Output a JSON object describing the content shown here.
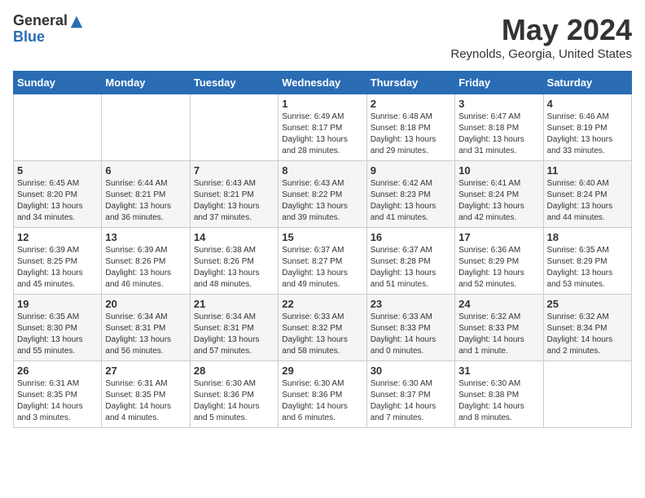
{
  "logo": {
    "general": "General",
    "blue": "Blue"
  },
  "title": "May 2024",
  "subtitle": "Reynolds, Georgia, United States",
  "days_header": [
    "Sunday",
    "Monday",
    "Tuesday",
    "Wednesday",
    "Thursday",
    "Friday",
    "Saturday"
  ],
  "weeks": [
    [
      {
        "day": "",
        "sunrise": "",
        "sunset": "",
        "daylight": ""
      },
      {
        "day": "",
        "sunrise": "",
        "sunset": "",
        "daylight": ""
      },
      {
        "day": "",
        "sunrise": "",
        "sunset": "",
        "daylight": ""
      },
      {
        "day": "1",
        "sunrise": "Sunrise: 6:49 AM",
        "sunset": "Sunset: 8:17 PM",
        "daylight": "Daylight: 13 hours and 28 minutes."
      },
      {
        "day": "2",
        "sunrise": "Sunrise: 6:48 AM",
        "sunset": "Sunset: 8:18 PM",
        "daylight": "Daylight: 13 hours and 29 minutes."
      },
      {
        "day": "3",
        "sunrise": "Sunrise: 6:47 AM",
        "sunset": "Sunset: 8:18 PM",
        "daylight": "Daylight: 13 hours and 31 minutes."
      },
      {
        "day": "4",
        "sunrise": "Sunrise: 6:46 AM",
        "sunset": "Sunset: 8:19 PM",
        "daylight": "Daylight: 13 hours and 33 minutes."
      }
    ],
    [
      {
        "day": "5",
        "sunrise": "Sunrise: 6:45 AM",
        "sunset": "Sunset: 8:20 PM",
        "daylight": "Daylight: 13 hours and 34 minutes."
      },
      {
        "day": "6",
        "sunrise": "Sunrise: 6:44 AM",
        "sunset": "Sunset: 8:21 PM",
        "daylight": "Daylight: 13 hours and 36 minutes."
      },
      {
        "day": "7",
        "sunrise": "Sunrise: 6:43 AM",
        "sunset": "Sunset: 8:21 PM",
        "daylight": "Daylight: 13 hours and 37 minutes."
      },
      {
        "day": "8",
        "sunrise": "Sunrise: 6:43 AM",
        "sunset": "Sunset: 8:22 PM",
        "daylight": "Daylight: 13 hours and 39 minutes."
      },
      {
        "day": "9",
        "sunrise": "Sunrise: 6:42 AM",
        "sunset": "Sunset: 8:23 PM",
        "daylight": "Daylight: 13 hours and 41 minutes."
      },
      {
        "day": "10",
        "sunrise": "Sunrise: 6:41 AM",
        "sunset": "Sunset: 8:24 PM",
        "daylight": "Daylight: 13 hours and 42 minutes."
      },
      {
        "day": "11",
        "sunrise": "Sunrise: 6:40 AM",
        "sunset": "Sunset: 8:24 PM",
        "daylight": "Daylight: 13 hours and 44 minutes."
      }
    ],
    [
      {
        "day": "12",
        "sunrise": "Sunrise: 6:39 AM",
        "sunset": "Sunset: 8:25 PM",
        "daylight": "Daylight: 13 hours and 45 minutes."
      },
      {
        "day": "13",
        "sunrise": "Sunrise: 6:39 AM",
        "sunset": "Sunset: 8:26 PM",
        "daylight": "Daylight: 13 hours and 46 minutes."
      },
      {
        "day": "14",
        "sunrise": "Sunrise: 6:38 AM",
        "sunset": "Sunset: 8:26 PM",
        "daylight": "Daylight: 13 hours and 48 minutes."
      },
      {
        "day": "15",
        "sunrise": "Sunrise: 6:37 AM",
        "sunset": "Sunset: 8:27 PM",
        "daylight": "Daylight: 13 hours and 49 minutes."
      },
      {
        "day": "16",
        "sunrise": "Sunrise: 6:37 AM",
        "sunset": "Sunset: 8:28 PM",
        "daylight": "Daylight: 13 hours and 51 minutes."
      },
      {
        "day": "17",
        "sunrise": "Sunrise: 6:36 AM",
        "sunset": "Sunset: 8:29 PM",
        "daylight": "Daylight: 13 hours and 52 minutes."
      },
      {
        "day": "18",
        "sunrise": "Sunrise: 6:35 AM",
        "sunset": "Sunset: 8:29 PM",
        "daylight": "Daylight: 13 hours and 53 minutes."
      }
    ],
    [
      {
        "day": "19",
        "sunrise": "Sunrise: 6:35 AM",
        "sunset": "Sunset: 8:30 PM",
        "daylight": "Daylight: 13 hours and 55 minutes."
      },
      {
        "day": "20",
        "sunrise": "Sunrise: 6:34 AM",
        "sunset": "Sunset: 8:31 PM",
        "daylight": "Daylight: 13 hours and 56 minutes."
      },
      {
        "day": "21",
        "sunrise": "Sunrise: 6:34 AM",
        "sunset": "Sunset: 8:31 PM",
        "daylight": "Daylight: 13 hours and 57 minutes."
      },
      {
        "day": "22",
        "sunrise": "Sunrise: 6:33 AM",
        "sunset": "Sunset: 8:32 PM",
        "daylight": "Daylight: 13 hours and 58 minutes."
      },
      {
        "day": "23",
        "sunrise": "Sunrise: 6:33 AM",
        "sunset": "Sunset: 8:33 PM",
        "daylight": "Daylight: 14 hours and 0 minutes."
      },
      {
        "day": "24",
        "sunrise": "Sunrise: 6:32 AM",
        "sunset": "Sunset: 8:33 PM",
        "daylight": "Daylight: 14 hours and 1 minute."
      },
      {
        "day": "25",
        "sunrise": "Sunrise: 6:32 AM",
        "sunset": "Sunset: 8:34 PM",
        "daylight": "Daylight: 14 hours and 2 minutes."
      }
    ],
    [
      {
        "day": "26",
        "sunrise": "Sunrise: 6:31 AM",
        "sunset": "Sunset: 8:35 PM",
        "daylight": "Daylight: 14 hours and 3 minutes."
      },
      {
        "day": "27",
        "sunrise": "Sunrise: 6:31 AM",
        "sunset": "Sunset: 8:35 PM",
        "daylight": "Daylight: 14 hours and 4 minutes."
      },
      {
        "day": "28",
        "sunrise": "Sunrise: 6:30 AM",
        "sunset": "Sunset: 8:36 PM",
        "daylight": "Daylight: 14 hours and 5 minutes."
      },
      {
        "day": "29",
        "sunrise": "Sunrise: 6:30 AM",
        "sunset": "Sunset: 8:36 PM",
        "daylight": "Daylight: 14 hours and 6 minutes."
      },
      {
        "day": "30",
        "sunrise": "Sunrise: 6:30 AM",
        "sunset": "Sunset: 8:37 PM",
        "daylight": "Daylight: 14 hours and 7 minutes."
      },
      {
        "day": "31",
        "sunrise": "Sunrise: 6:30 AM",
        "sunset": "Sunset: 8:38 PM",
        "daylight": "Daylight: 14 hours and 8 minutes."
      },
      {
        "day": "",
        "sunrise": "",
        "sunset": "",
        "daylight": ""
      }
    ]
  ]
}
